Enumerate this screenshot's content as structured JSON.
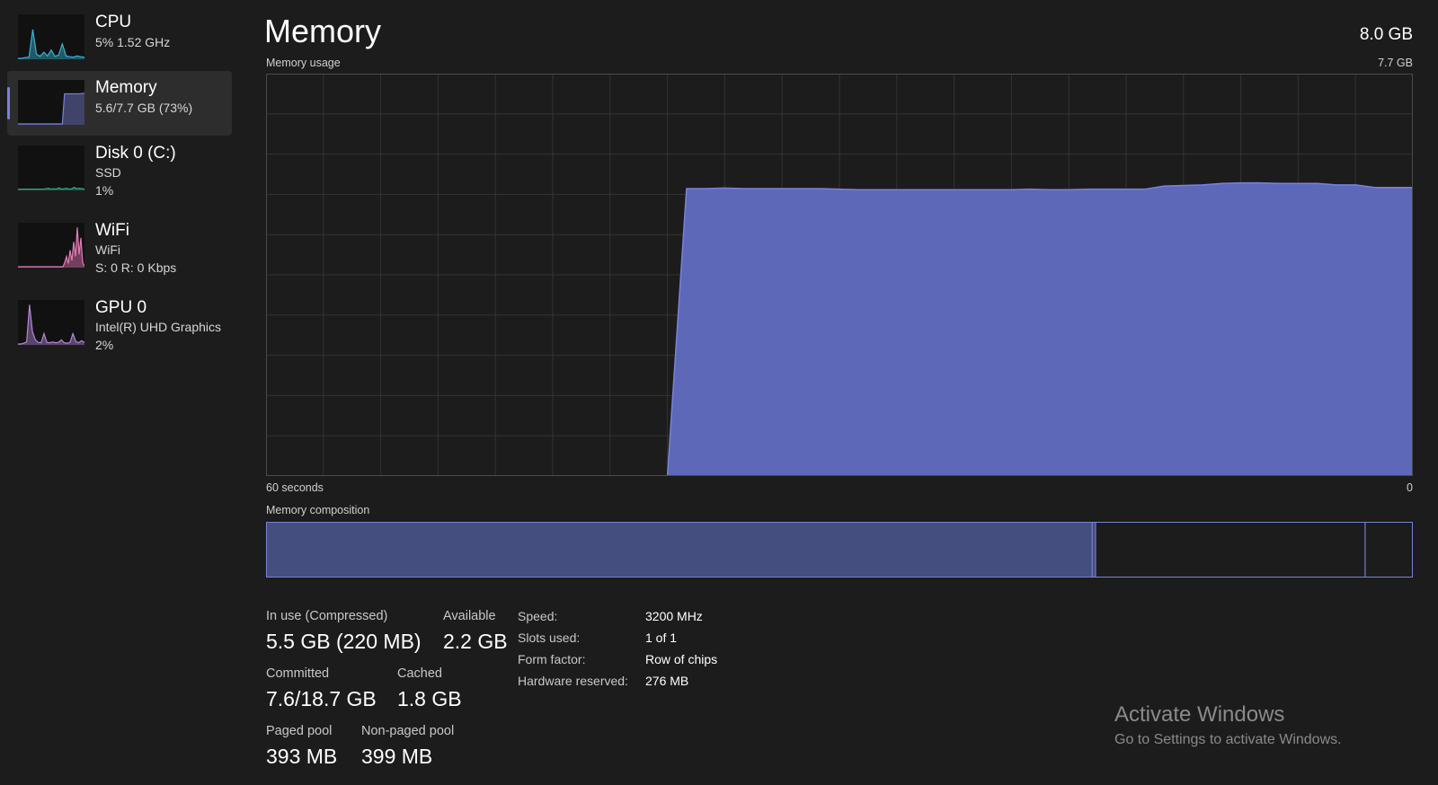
{
  "sidebar": {
    "items": [
      {
        "title": "CPU",
        "line1": "5% 1.52 GHz",
        "line2": "",
        "selected": false,
        "icon": "cpu-graph",
        "color": "#3ab2d0",
        "series": [
          0,
          0,
          2,
          3,
          70,
          10,
          5,
          15,
          6,
          20,
          5,
          8,
          35,
          6,
          4,
          3,
          6,
          4,
          3
        ]
      },
      {
        "title": "Memory",
        "line1": "5.6/7.7 GB (73%)",
        "line2": "",
        "selected": true,
        "icon": "memory-graph",
        "color": "#7a82d6",
        "series": [
          0,
          0,
          0,
          0,
          0,
          0,
          0,
          0,
          0,
          0,
          0,
          0,
          0,
          0,
          0,
          0,
          0,
          0,
          0,
          0,
          0,
          73,
          73,
          73,
          73,
          73,
          73,
          73,
          73,
          74,
          74
        ]
      },
      {
        "title": "Disk 0 (C:)",
        "line1": "SSD",
        "line2": "1%",
        "selected": false,
        "icon": "disk-graph",
        "color": "#3aa68a",
        "series": [
          1,
          1,
          1,
          1,
          1,
          1,
          1,
          1,
          1,
          1,
          1,
          2,
          3,
          1,
          2,
          1,
          4,
          1,
          2,
          3,
          1,
          2,
          5,
          2,
          3,
          2,
          1
        ]
      },
      {
        "title": "WiFi",
        "line1": "WiFi",
        "line2": "S: 0 R: 0 Kbps",
        "selected": false,
        "icon": "wifi-graph",
        "color": "#e57ab8",
        "series": [
          0,
          0,
          0,
          0,
          0,
          0,
          0,
          0,
          0,
          0,
          0,
          0,
          0,
          0,
          0,
          0,
          0,
          0,
          0,
          0,
          0,
          0,
          0,
          0,
          0,
          0,
          10,
          25,
          8,
          40,
          15,
          60,
          25,
          95,
          30,
          70,
          10,
          2
        ]
      },
      {
        "title": "GPU 0",
        "line1": "Intel(R) UHD Graphics",
        "line2": "2%",
        "selected": false,
        "icon": "gpu-graph",
        "color": "#b486d6",
        "series": [
          0,
          0,
          2,
          5,
          95,
          30,
          10,
          4,
          3,
          25,
          4,
          3,
          5,
          3,
          4,
          10,
          3,
          2,
          4,
          25,
          6,
          3,
          8,
          4
        ]
      }
    ]
  },
  "page": {
    "title": "Memory",
    "total": "8.0 GB",
    "usage_label": "Memory usage",
    "usage_max": "7.7 GB",
    "time_left": "60 seconds",
    "time_right": "0",
    "composition_label": "Memory composition"
  },
  "chart_data": {
    "type": "area",
    "title": "Memory usage",
    "x_unit": "seconds",
    "xlim": [
      60,
      0
    ],
    "ylim": [
      0,
      7.7
    ],
    "y_unit": "GB",
    "grid": true,
    "color": "#5d68b9",
    "x": [
      60,
      59,
      58,
      57,
      56,
      55,
      54,
      53,
      52,
      51,
      50,
      49,
      48,
      47,
      46,
      45,
      44,
      43,
      42,
      41,
      40,
      39,
      38,
      37,
      36,
      35,
      34,
      33,
      32,
      31,
      30,
      29,
      28,
      27,
      26,
      25,
      24,
      23,
      22,
      21,
      20,
      19,
      18,
      17,
      16,
      15,
      14,
      13,
      12,
      11,
      10,
      9,
      8,
      7,
      6,
      5,
      4,
      3,
      2,
      1,
      0
    ],
    "values": [
      0,
      0,
      0,
      0,
      0,
      0,
      0,
      0,
      0,
      0,
      0,
      0,
      0,
      0,
      0,
      0,
      0,
      0,
      0,
      0,
      0,
      0,
      5.5,
      5.5,
      5.51,
      5.5,
      5.5,
      5.5,
      5.5,
      5.5,
      5.49,
      5.48,
      5.48,
      5.48,
      5.48,
      5.48,
      5.48,
      5.48,
      5.48,
      5.48,
      5.49,
      5.48,
      5.48,
      5.49,
      5.49,
      5.49,
      5.49,
      5.55,
      5.56,
      5.57,
      5.6,
      5.61,
      5.61,
      5.6,
      5.6,
      5.6,
      5.57,
      5.57,
      5.52,
      5.52,
      5.52
    ]
  },
  "composition": {
    "in_use_fraction": 0.72,
    "modified_fraction": 0.003,
    "standby_fraction": 0.235,
    "free_fraction": 0.046,
    "fill_color": "#444e7f",
    "border_color": "#7a82d6"
  },
  "stats": {
    "in_use_label": "In use (Compressed)",
    "in_use_value": "5.5 GB (220 MB)",
    "available_label": "Available",
    "available_value": "2.2 GB",
    "committed_label": "Committed",
    "committed_value": "7.6/18.7 GB",
    "cached_label": "Cached",
    "cached_value": "1.8 GB",
    "paged_label": "Paged pool",
    "paged_value": "393 MB",
    "nonpaged_label": "Non-paged pool",
    "nonpaged_value": "399 MB"
  },
  "details": {
    "speed_label": "Speed:",
    "speed_value": "3200 MHz",
    "slots_label": "Slots used:",
    "slots_value": "1 of 1",
    "form_label": "Form factor:",
    "form_value": "Row of chips",
    "reserved_label": "Hardware reserved:",
    "reserved_value": "276 MB"
  },
  "watermark": {
    "title": "Activate Windows",
    "subtitle": "Go to Settings to activate Windows."
  }
}
